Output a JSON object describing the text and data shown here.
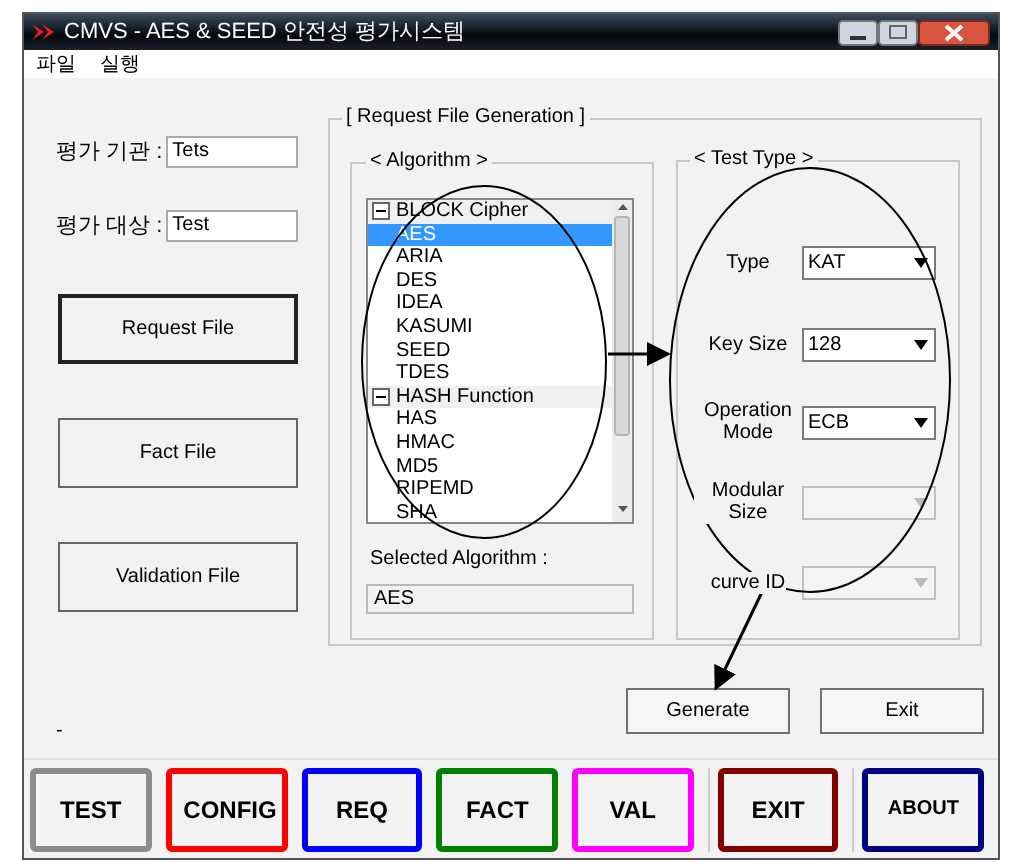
{
  "window": {
    "title": "CMVS - AES & SEED 안전성 평가시스템"
  },
  "menu": [
    {
      "label": "파일"
    },
    {
      "label": "실행"
    }
  ],
  "info_fields": [
    {
      "label": "평가 기관 :",
      "value": "Tets"
    },
    {
      "label": "평가 대상 :",
      "value": "Test"
    }
  ],
  "side_buttons": [
    {
      "label": "Request File",
      "selected": true
    },
    {
      "label": "Fact File",
      "selected": false
    },
    {
      "label": "Validation File",
      "selected": false
    }
  ],
  "request_group": {
    "title": "[ Request File Generation ]",
    "algorithm": {
      "title": "< Algorithm >",
      "tree": [
        {
          "label": "BLOCK Cipher",
          "expanded": true,
          "children": [
            {
              "label": "AES",
              "selected": true
            },
            {
              "label": "ARIA",
              "selected": false
            },
            {
              "label": "DES",
              "selected": false
            },
            {
              "label": "IDEA",
              "selected": false
            },
            {
              "label": "KASUMI",
              "selected": false
            },
            {
              "label": "SEED",
              "selected": false
            },
            {
              "label": "TDES",
              "selected": false
            }
          ]
        },
        {
          "label": "HASH Function",
          "expanded": true,
          "children": [
            {
              "label": "HAS",
              "selected": false
            },
            {
              "label": "HMAC",
              "selected": false
            },
            {
              "label": "MD5",
              "selected": false
            },
            {
              "label": "RIPEMD",
              "selected": false
            },
            {
              "label": "SHA",
              "selected": false
            }
          ]
        }
      ],
      "selected_label": "Selected Algorithm :",
      "selected_value": "AES"
    },
    "test_type": {
      "title": "< Test Type >",
      "fields": [
        {
          "label": "Type",
          "value": "KAT",
          "disabled": false
        },
        {
          "label": "Key Size",
          "value": "128",
          "disabled": false
        },
        {
          "label": "Operation Mode",
          "value": "ECB",
          "disabled": false
        },
        {
          "label": "Modular Size",
          "disabled": true
        },
        {
          "label": "curve ID",
          "disabled": true
        }
      ]
    }
  },
  "actions": [
    {
      "label": "Generate"
    },
    {
      "label": "Exit"
    }
  ],
  "status_text": "-",
  "toolbar": [
    {
      "label": "TEST",
      "color": "#8c8c8c"
    },
    {
      "label": "CONFIG",
      "color": "#ff0000"
    },
    {
      "label": "REQ",
      "color": "#0000ff"
    },
    {
      "label": "FACT",
      "color": "#008000"
    },
    {
      "label": "VAL",
      "color": "#ff00ff"
    },
    {
      "label": "EXIT",
      "color": "#800000"
    },
    {
      "label": "ABOUT",
      "color": "#000080"
    }
  ]
}
